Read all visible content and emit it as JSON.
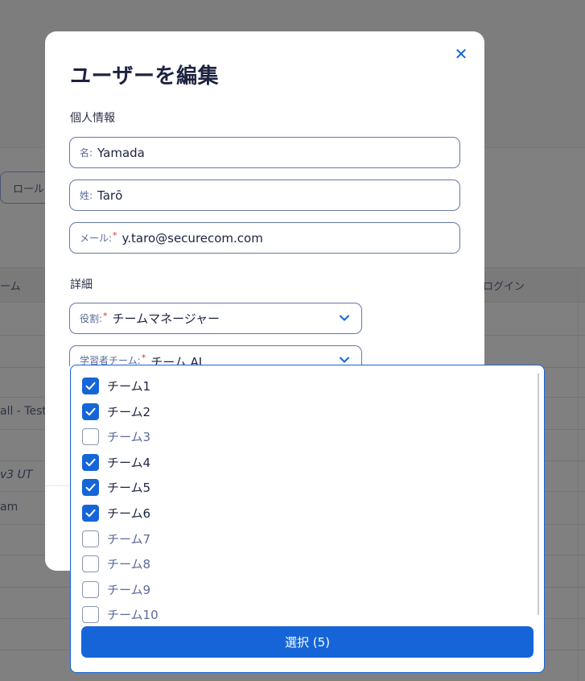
{
  "background": {
    "role_button_label": "ロール",
    "table_header_left": "ーム",
    "table_header_right": "ログイン",
    "rows": [
      {
        "text": "all - Test",
        "italic": false
      },
      {
        "text": "v3 UT",
        "italic": true
      },
      {
        "text": "am",
        "italic": false
      }
    ]
  },
  "modal": {
    "title": "ユーザーを編集",
    "close_icon": "close-icon",
    "personal_section_label": "個人情報",
    "first_name": {
      "label": "名:",
      "value": "Yamada"
    },
    "last_name": {
      "label": "姓:",
      "value": "Tarō"
    },
    "email": {
      "label": "メール:",
      "required_mark": "*",
      "value": "y.taro@securecom.com"
    },
    "details_section_label": "詳細",
    "role": {
      "label": "役割:",
      "required_mark": "*",
      "value": "チームマネージャー"
    },
    "learner_team": {
      "label": "学習者チーム:",
      "required_mark": "*",
      "value": "チーム AI"
    }
  },
  "dropdown": {
    "options": [
      {
        "label": "チーム1",
        "checked": true
      },
      {
        "label": "チーム2",
        "checked": true
      },
      {
        "label": "チーム3",
        "checked": false
      },
      {
        "label": "チーム4",
        "checked": true
      },
      {
        "label": "チーム5",
        "checked": true
      },
      {
        "label": "チーム6",
        "checked": true
      },
      {
        "label": "チーム7",
        "checked": false
      },
      {
        "label": "チーム8",
        "checked": false
      },
      {
        "label": "チーム9",
        "checked": false
      },
      {
        "label": "チーム10",
        "checked": false
      }
    ],
    "select_button_label": "選択 (5)"
  },
  "colors": {
    "accent": "#1565d8",
    "required": "#d8343c",
    "overlay": "#808080"
  }
}
